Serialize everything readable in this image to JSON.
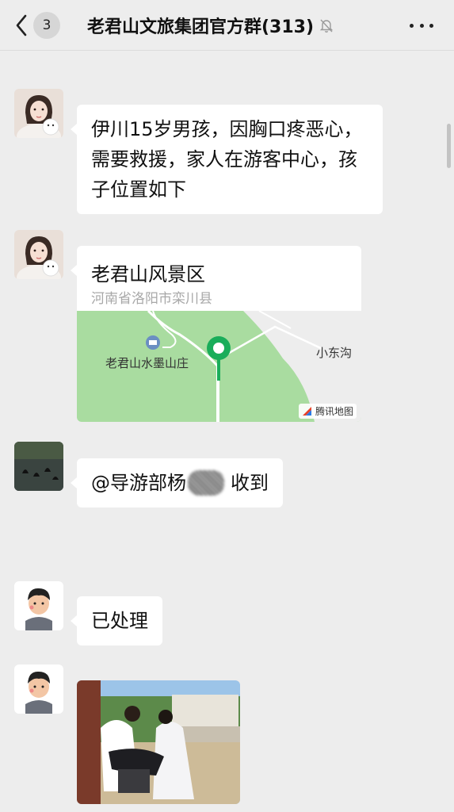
{
  "header": {
    "unread_count": "3",
    "title": "老君山文旅集团官方群(313)"
  },
  "messages": [
    {
      "type": "text",
      "text": "伊川15岁男孩，因胸口疼恶心，需要救援，家人在游客中心，孩子位置如下"
    },
    {
      "type": "location",
      "name": "老君山风景区",
      "address": "河南省洛阳市栾川县",
      "map": {
        "poi_label": "老君山水墨山庄",
        "place_label": "小东沟",
        "provider": "腾讯地图"
      }
    },
    {
      "type": "text",
      "prefix": "@导游部杨",
      "suffix": "收到"
    },
    {
      "type": "text",
      "text": "已处理"
    },
    {
      "type": "image"
    }
  ],
  "colors": {
    "background": "#ededed",
    "bubble": "#ffffff",
    "map_green": "#a9dca0",
    "pin": "#1aad5a"
  }
}
